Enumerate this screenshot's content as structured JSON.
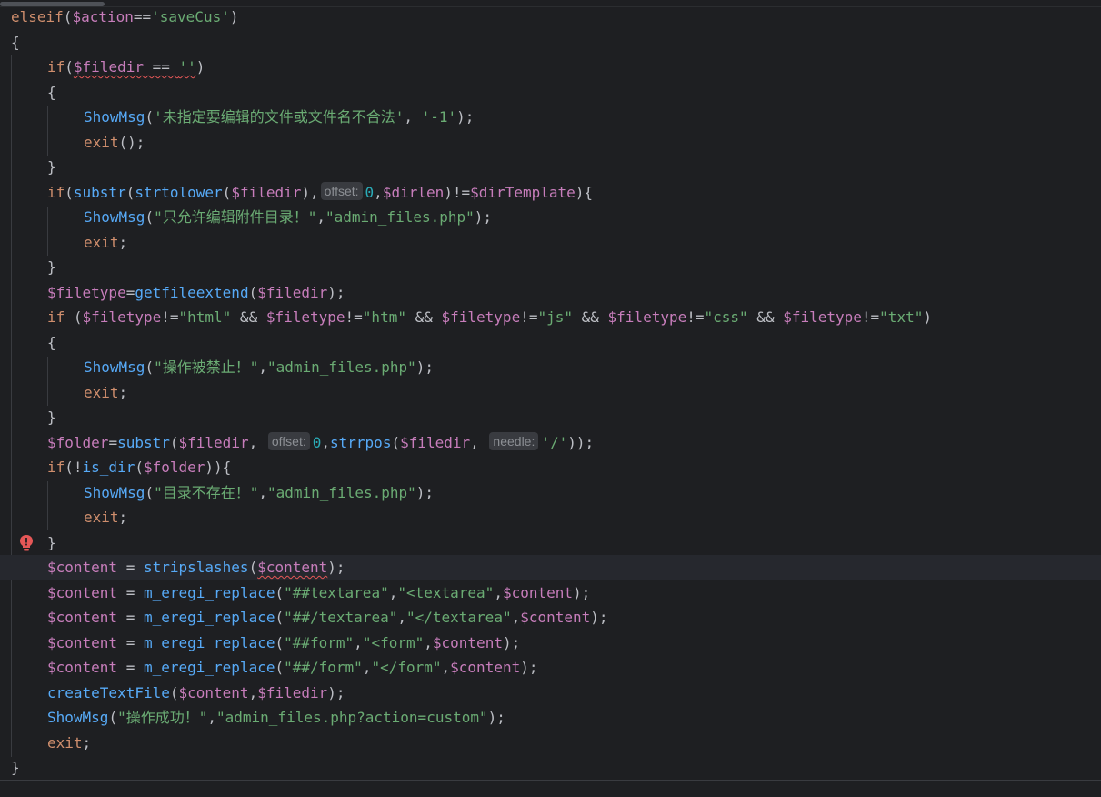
{
  "editor": {
    "lines": [
      {
        "indent": 0,
        "tokens": [
          [
            "kw",
            "elseif"
          ],
          [
            "plain",
            "("
          ],
          [
            "var",
            "$action"
          ],
          [
            "plain",
            "=="
          ],
          [
            "str",
            "'saveCus'"
          ],
          [
            "plain",
            ")"
          ]
        ]
      },
      {
        "indent": 0,
        "tokens": [
          [
            "plain",
            "{"
          ]
        ]
      },
      {
        "indent": 1,
        "tokens": [
          [
            "kw",
            "if"
          ],
          [
            "plain",
            "("
          ],
          [
            "var squig",
            "$filedir"
          ],
          [
            "plain squig",
            " == "
          ],
          [
            "str squig",
            "''"
          ],
          [
            "plain",
            ")"
          ]
        ]
      },
      {
        "indent": 1,
        "tokens": [
          [
            "plain",
            "{"
          ]
        ]
      },
      {
        "indent": 2,
        "tokens": [
          [
            "fn",
            "ShowMsg"
          ],
          [
            "plain",
            "("
          ],
          [
            "str",
            "'未指定要编辑的文件或文件名不合法'"
          ],
          [
            "plain",
            ", "
          ],
          [
            "str",
            "'-1'"
          ],
          [
            "plain",
            ");"
          ]
        ]
      },
      {
        "indent": 2,
        "tokens": [
          [
            "kw",
            "exit"
          ],
          [
            "plain",
            "();"
          ]
        ]
      },
      {
        "indent": 1,
        "tokens": [
          [
            "plain",
            "}"
          ]
        ]
      },
      {
        "indent": 1,
        "tokens": [
          [
            "kw",
            "if"
          ],
          [
            "plain",
            "("
          ],
          [
            "fn2",
            "substr"
          ],
          [
            "plain",
            "("
          ],
          [
            "fn2",
            "strtolower"
          ],
          [
            "plain",
            "("
          ],
          [
            "var",
            "$filedir"
          ],
          [
            "plain",
            "),"
          ],
          [
            "hint",
            "offset:"
          ],
          [
            "num",
            "0"
          ],
          [
            "plain",
            ","
          ],
          [
            "var",
            "$dirlen"
          ],
          [
            "plain",
            ")!="
          ],
          [
            "var",
            "$dirTemplate"
          ],
          [
            "plain",
            "){"
          ]
        ]
      },
      {
        "indent": 2,
        "tokens": [
          [
            "fn",
            "ShowMsg"
          ],
          [
            "plain",
            "("
          ],
          [
            "str",
            "\"只允许编辑附件目录！\""
          ],
          [
            "plain",
            ","
          ],
          [
            "str",
            "\"admin_files.php\""
          ],
          [
            "plain",
            ");"
          ]
        ]
      },
      {
        "indent": 2,
        "tokens": [
          [
            "kw",
            "exit"
          ],
          [
            "plain",
            ";"
          ]
        ]
      },
      {
        "indent": 1,
        "tokens": [
          [
            "plain",
            "}"
          ]
        ]
      },
      {
        "indent": 1,
        "tokens": [
          [
            "var",
            "$filetype"
          ],
          [
            "plain",
            "="
          ],
          [
            "fn2",
            "getfileextend"
          ],
          [
            "plain",
            "("
          ],
          [
            "var",
            "$filedir"
          ],
          [
            "plain",
            ");"
          ]
        ]
      },
      {
        "indent": 1,
        "tokens": [
          [
            "kw",
            "if"
          ],
          [
            "plain",
            " ("
          ],
          [
            "var",
            "$filetype"
          ],
          [
            "plain",
            "!="
          ],
          [
            "str",
            "\"html\""
          ],
          [
            "plain",
            " && "
          ],
          [
            "var",
            "$filetype"
          ],
          [
            "plain",
            "!="
          ],
          [
            "str",
            "\"htm\""
          ],
          [
            "plain",
            " && "
          ],
          [
            "var",
            "$filetype"
          ],
          [
            "plain",
            "!="
          ],
          [
            "str",
            "\"js\""
          ],
          [
            "plain",
            " && "
          ],
          [
            "var",
            "$filetype"
          ],
          [
            "plain",
            "!="
          ],
          [
            "str",
            "\"css\""
          ],
          [
            "plain",
            " && "
          ],
          [
            "var",
            "$filetype"
          ],
          [
            "plain",
            "!="
          ],
          [
            "str",
            "\"txt\""
          ],
          [
            "plain",
            ")"
          ]
        ]
      },
      {
        "indent": 1,
        "tokens": [
          [
            "plain",
            "{"
          ]
        ]
      },
      {
        "indent": 2,
        "tokens": [
          [
            "fn",
            "ShowMsg"
          ],
          [
            "plain",
            "("
          ],
          [
            "str",
            "\"操作被禁止！\""
          ],
          [
            "plain",
            ","
          ],
          [
            "str",
            "\"admin_files.php\""
          ],
          [
            "plain",
            ");"
          ]
        ]
      },
      {
        "indent": 2,
        "tokens": [
          [
            "kw",
            "exit"
          ],
          [
            "plain",
            ";"
          ]
        ]
      },
      {
        "indent": 1,
        "tokens": [
          [
            "plain",
            "}"
          ]
        ]
      },
      {
        "indent": 1,
        "tokens": [
          [
            "var",
            "$folder"
          ],
          [
            "plain",
            "="
          ],
          [
            "fn2",
            "substr"
          ],
          [
            "plain",
            "("
          ],
          [
            "var",
            "$filedir"
          ],
          [
            "plain",
            ", "
          ],
          [
            "hint",
            "offset:"
          ],
          [
            "num",
            "0"
          ],
          [
            "plain",
            ","
          ],
          [
            "fn2",
            "strrpos"
          ],
          [
            "plain",
            "("
          ],
          [
            "var",
            "$filedir"
          ],
          [
            "plain",
            ", "
          ],
          [
            "hint",
            "needle:"
          ],
          [
            "str",
            "'/'"
          ],
          [
            "plain",
            "));"
          ]
        ]
      },
      {
        "indent": 1,
        "tokens": [
          [
            "kw",
            "if"
          ],
          [
            "plain",
            "(!"
          ],
          [
            "fn2",
            "is_dir"
          ],
          [
            "plain",
            "("
          ],
          [
            "var",
            "$folder"
          ],
          [
            "plain",
            "))"
          ],
          [
            "plain",
            "{"
          ]
        ]
      },
      {
        "indent": 2,
        "tokens": [
          [
            "fn",
            "ShowMsg"
          ],
          [
            "plain",
            "("
          ],
          [
            "str",
            "\"目录不存在！\""
          ],
          [
            "plain",
            ","
          ],
          [
            "str",
            "\"admin_files.php\""
          ],
          [
            "plain",
            ");"
          ]
        ]
      },
      {
        "indent": 2,
        "tokens": [
          [
            "kw",
            "exit"
          ],
          [
            "plain",
            ";"
          ]
        ]
      },
      {
        "indent": 1,
        "tokens": [
          [
            "plain",
            "}"
          ]
        ],
        "icon": "error-bulb-icon"
      },
      {
        "indent": 1,
        "current": true,
        "tokens": [
          [
            "var",
            "$content"
          ],
          [
            "plain",
            " = "
          ],
          [
            "fn2",
            "stripslashes"
          ],
          [
            "plain",
            "("
          ],
          [
            "var squig",
            "$content"
          ],
          [
            "plain",
            ");"
          ]
        ]
      },
      {
        "indent": 1,
        "tokens": [
          [
            "var",
            "$content"
          ],
          [
            "plain",
            " = "
          ],
          [
            "fn2",
            "m_eregi_replace"
          ],
          [
            "plain",
            "("
          ],
          [
            "str",
            "\"##textarea\""
          ],
          [
            "plain",
            ","
          ],
          [
            "str",
            "\"<textarea\""
          ],
          [
            "plain",
            ","
          ],
          [
            "var",
            "$content"
          ],
          [
            "plain",
            ");"
          ]
        ]
      },
      {
        "indent": 1,
        "tokens": [
          [
            "var",
            "$content"
          ],
          [
            "plain",
            " = "
          ],
          [
            "fn2",
            "m_eregi_replace"
          ],
          [
            "plain",
            "("
          ],
          [
            "str",
            "\"##/textarea\""
          ],
          [
            "plain",
            ","
          ],
          [
            "str",
            "\"</textarea\""
          ],
          [
            "plain",
            ","
          ],
          [
            "var",
            "$content"
          ],
          [
            "plain",
            ");"
          ]
        ]
      },
      {
        "indent": 1,
        "tokens": [
          [
            "var",
            "$content"
          ],
          [
            "plain",
            " = "
          ],
          [
            "fn2",
            "m_eregi_replace"
          ],
          [
            "plain",
            "("
          ],
          [
            "str",
            "\"##form\""
          ],
          [
            "plain",
            ","
          ],
          [
            "str",
            "\"<form\""
          ],
          [
            "plain",
            ","
          ],
          [
            "var",
            "$content"
          ],
          [
            "plain",
            ");"
          ]
        ]
      },
      {
        "indent": 1,
        "tokens": [
          [
            "var",
            "$content"
          ],
          [
            "plain",
            " = "
          ],
          [
            "fn2",
            "m_eregi_replace"
          ],
          [
            "plain",
            "("
          ],
          [
            "str",
            "\"##/form\""
          ],
          [
            "plain",
            ","
          ],
          [
            "str",
            "\"</form\""
          ],
          [
            "plain",
            ","
          ],
          [
            "var",
            "$content"
          ],
          [
            "plain",
            ");"
          ]
        ]
      },
      {
        "indent": 1,
        "tokens": [
          [
            "fn2",
            "createTextFile"
          ],
          [
            "plain",
            "("
          ],
          [
            "var",
            "$content"
          ],
          [
            "plain",
            ","
          ],
          [
            "var",
            "$filedir"
          ],
          [
            "plain",
            ");"
          ]
        ]
      },
      {
        "indent": 1,
        "tokens": [
          [
            "fn2",
            "ShowMsg"
          ],
          [
            "plain",
            "("
          ],
          [
            "str",
            "\"操作成功！\""
          ],
          [
            "plain",
            ","
          ],
          [
            "str",
            "\"admin_files.php?action=custom\""
          ],
          [
            "plain",
            ");"
          ]
        ]
      },
      {
        "indent": 1,
        "tokens": [
          [
            "kw",
            "exit"
          ],
          [
            "plain",
            ";"
          ]
        ]
      },
      {
        "indent": 0,
        "tokens": [
          [
            "plain",
            "}"
          ]
        ]
      }
    ]
  }
}
